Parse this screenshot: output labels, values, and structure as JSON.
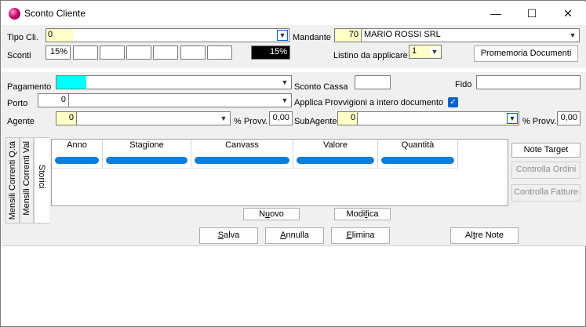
{
  "window": {
    "title": "Sconto Cliente",
    "controls": {
      "minimize": "—",
      "maximize": "☐",
      "close": "✕"
    }
  },
  "header": {
    "tipo_cli_label": "Tipo Cli.",
    "tipo_cli_value": "0",
    "mandante_label": "Mandante",
    "mandante_code": "70",
    "mandante_name": "MARIO ROSSI SRL",
    "sconti_label": "Sconti",
    "sconti_values": [
      "15%",
      "",
      "",
      "",
      "",
      "",
      ""
    ],
    "sconto_totale": "15%",
    "listino_label": "Listino da applicare",
    "listino_value": "1",
    "promemoria_button": "Promemoria  Documenti"
  },
  "details": {
    "pagamento_label": "Pagamento",
    "sconto_cassa_label": "Sconto Cassa",
    "fido_label": "Fido",
    "porto_label": "Porto",
    "porto_value": "0",
    "applica_provvigioni_label": "Applica Provvigioni a intero documento",
    "applica_provvigioni_checked": true,
    "agente_label": "Agente",
    "agente_value": "0",
    "agente_provv_label": "% Provv.",
    "agente_provv_value": "0,00",
    "subagente_label": "SubAgente",
    "subagente_value": "0",
    "subagente_provv_label": "% Provv.",
    "subagente_provv_value": "0,00"
  },
  "tabs": [
    {
      "label": "Mensili Correnti  Q.tà"
    },
    {
      "label": "Mensili Correnti  Val"
    },
    {
      "label": "Storici"
    }
  ],
  "grid": {
    "columns": [
      "Anno",
      "Stagione",
      "Canvass",
      "Valore",
      "Quantità"
    ]
  },
  "side_buttons": {
    "note_target": "Note Target",
    "controlla_ordini": "Controlla Ordini",
    "controlla_fatture": "Controlla Fatture"
  },
  "grid_buttons": {
    "nuovo_pre": "N",
    "nuovo_u": "u",
    "nuovo_post": "ovo",
    "modifica_pre": "Modi",
    "modifica_u": "f",
    "modifica_post": "ica"
  },
  "footer": {
    "salva_u": "S",
    "salva_post": "alva",
    "annulla_u": "A",
    "annulla_post": "nnulla",
    "elimina_u": "E",
    "elimina_post": "limina",
    "altre_note_pre": "Al",
    "altre_note_u": "t",
    "altre_note_post": "re Note"
  },
  "colors": {
    "accent": "#0a7ed9",
    "field_yellow": "#ffffc8",
    "field_cyan": "#00ffff"
  }
}
